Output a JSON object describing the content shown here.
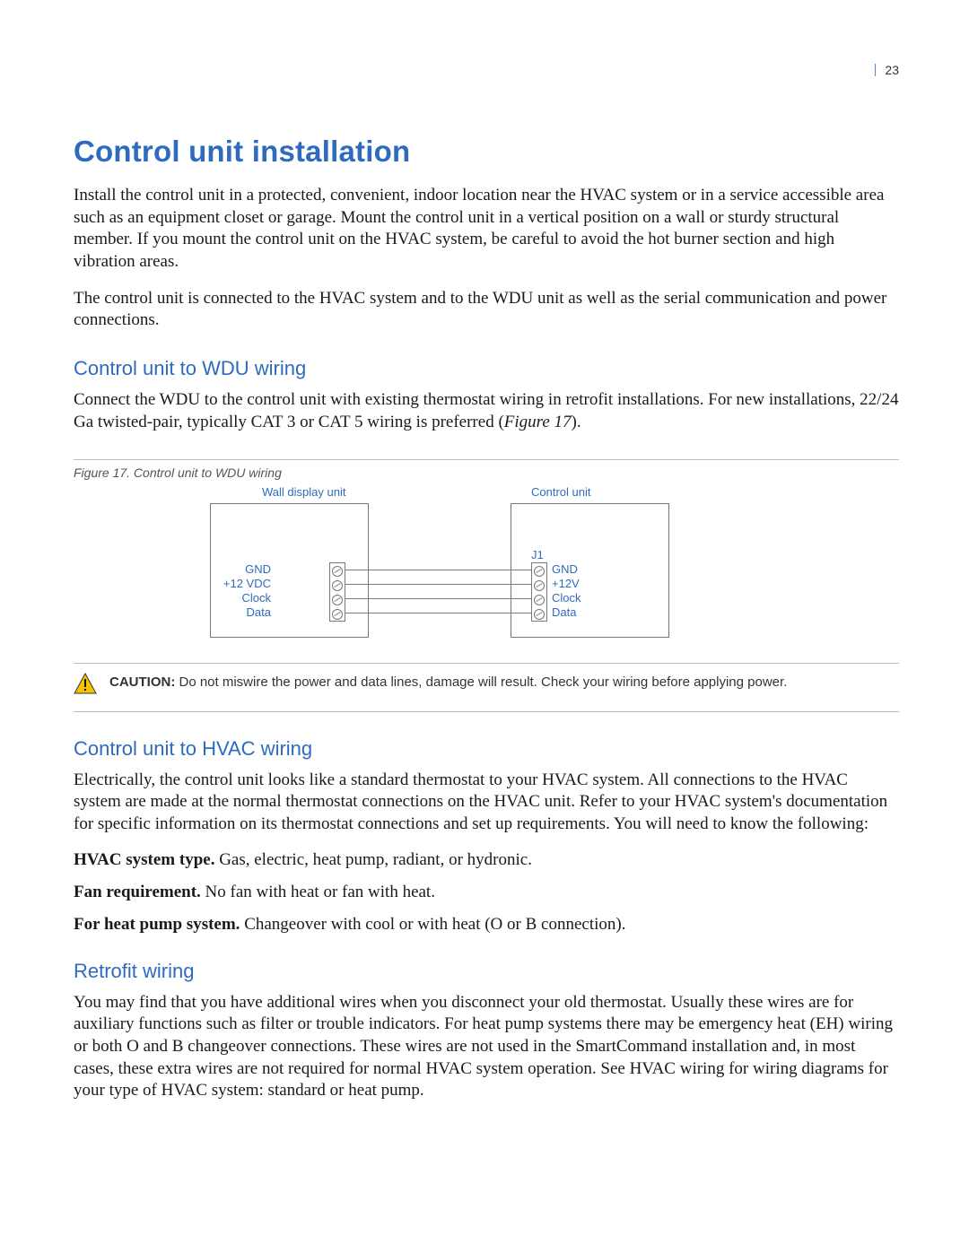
{
  "page_number": "23",
  "title": "Control unit installation",
  "intro_p1": "Install the control unit in a protected, convenient, indoor location near the HVAC system or in a service accessible area such as an equipment closet or garage. Mount the control unit in a vertical position on a wall or sturdy structural member. If you mount the control unit on the HVAC system, be careful to avoid the hot burner section and high vibration areas.",
  "intro_p2": "The control unit is connected to the HVAC system and to the WDU unit as well as the serial communication and power connections.",
  "section_wdu": {
    "heading": "Control unit to WDU wiring",
    "p1_a": "Connect the WDU to the control unit with existing thermostat wiring in retrofit installations. For new installations, 22/24 Ga twisted-pair, typically CAT 3 or CAT 5 wiring is preferred (",
    "p1_figref": "Figure 17",
    "p1_b": ")."
  },
  "figure": {
    "caption": "Figure 17.  Control unit to WDU wiring",
    "left_title": "Wall display unit",
    "right_title": "Control unit",
    "j1": "J1",
    "left_terms": [
      "GND",
      "+12 VDC",
      "Clock",
      "Data"
    ],
    "right_terms": [
      "GND",
      "+12V",
      "Clock",
      "Data"
    ]
  },
  "caution": {
    "label": "CAUTION:",
    "text": "  Do not miswire the power and data lines, damage will result. Check your wiring before applying power."
  },
  "section_hvac": {
    "heading": "Control unit to HVAC wiring",
    "p1": "Electrically, the control unit looks like a standard thermostat to your HVAC system. All connections to the HVAC system are made at the normal thermostat connections on the HVAC unit. Refer to your HVAC system's documentation for specific information on its thermostat connections and set up requirements. You will need to know the following:",
    "defs": [
      {
        "term": "HVAC system type.",
        "desc": "  Gas, electric, heat pump, radiant, or hydronic."
      },
      {
        "term": "Fan requirement.",
        "desc": "  No fan with heat or fan with heat."
      },
      {
        "term": "For heat pump system.",
        "desc": "  Changeover with cool or with heat (O or B connection)."
      }
    ]
  },
  "section_retro": {
    "heading": "Retrofit wiring",
    "p1": "You may find that you have additional wires when you disconnect your old thermostat. Usually these wires are for auxiliary functions such as filter or trouble indicators. For heat pump systems there may be emergency heat (EH) wiring or both O and B changeover connections. These wires are not used in the SmartCommand installation and, in most cases, these extra wires are not required for normal HVAC system operation. See HVAC wiring for wiring diagrams for your type of HVAC system: standard or heat pump."
  }
}
